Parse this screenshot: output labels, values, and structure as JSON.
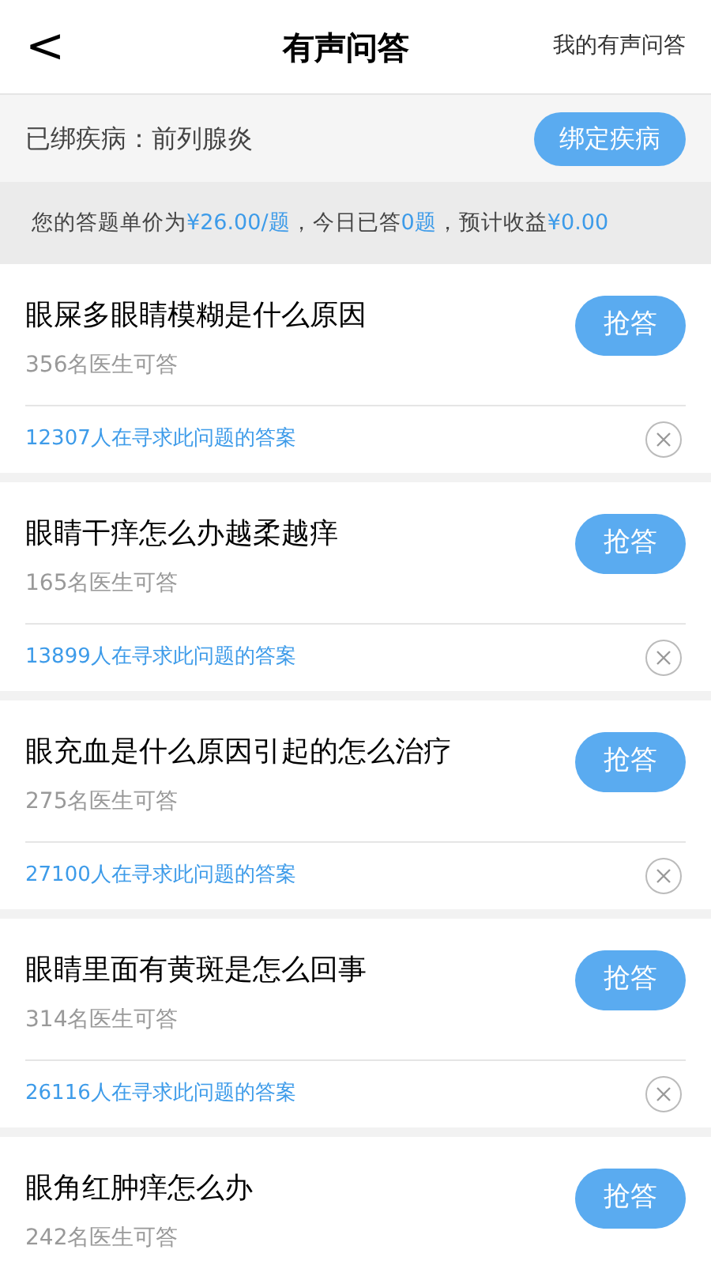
{
  "header": {
    "back": "<",
    "title": "有声问答",
    "link": "我的有声问答"
  },
  "bound": {
    "label": "已绑疾病：前列腺炎",
    "button": "绑定疾病"
  },
  "info": [
    {
      "text": "您的答题单价为",
      "highlight": false
    },
    {
      "text": "¥26.00/题",
      "highlight": true
    },
    {
      "text": "，今日已答",
      "highlight": false
    },
    {
      "text": "0题",
      "highlight": true
    },
    {
      "text": "，预计收益",
      "highlight": false
    },
    {
      "text": "¥0.00",
      "highlight": true
    }
  ],
  "questions": [
    {
      "title": "眼屎多眼睛模糊是什么原因",
      "doctors": "356名医生可答",
      "button": "抢答",
      "seekers": "12307人在寻求此问题的答案"
    },
    {
      "title": "眼睛干痒怎么办越柔越痒",
      "doctors": "165名医生可答",
      "button": "抢答",
      "seekers": "13899人在寻求此问题的答案"
    },
    {
      "title": "眼充血是什么原因引起的怎么治疗",
      "doctors": "275名医生可答",
      "button": "抢答",
      "seekers": "27100人在寻求此问题的答案"
    },
    {
      "title": "眼睛里面有黄斑是怎么回事",
      "doctors": "314名医生可答",
      "button": "抢答",
      "seekers": "26116人在寻求此问题的答案"
    },
    {
      "title": "眼角红肿痒怎么办",
      "doctors": "242名医生可答",
      "button": "抢答"
    }
  ]
}
